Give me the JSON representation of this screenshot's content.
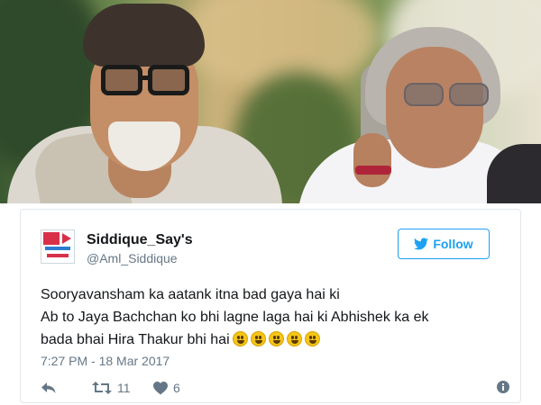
{
  "tweet": {
    "display_name": "Siddique_Say's",
    "handle": "@Aml_Siddique",
    "follow_label": "Follow",
    "text_lines": [
      "Sooryavansham ka aatank itna bad gaya hai ki",
      "Ab to Jaya Bachchan ko bhi lagne laga hai ki Abhishek ka ek",
      "bada bhai Hira Thakur bhi hai"
    ],
    "timestamp": "7:27 PM - 18 Mar 2017",
    "retweet_count": "11",
    "like_count": "6"
  },
  "icons": {
    "reply": "reply-icon",
    "retweet": "retweet-icon",
    "like": "heart-icon",
    "info": "info-icon",
    "follow": "twitter-bird-icon"
  },
  "colors": {
    "accent": "#1da1f2",
    "text": "#14171a",
    "muted": "#657786",
    "border": "#e1e8ed"
  }
}
